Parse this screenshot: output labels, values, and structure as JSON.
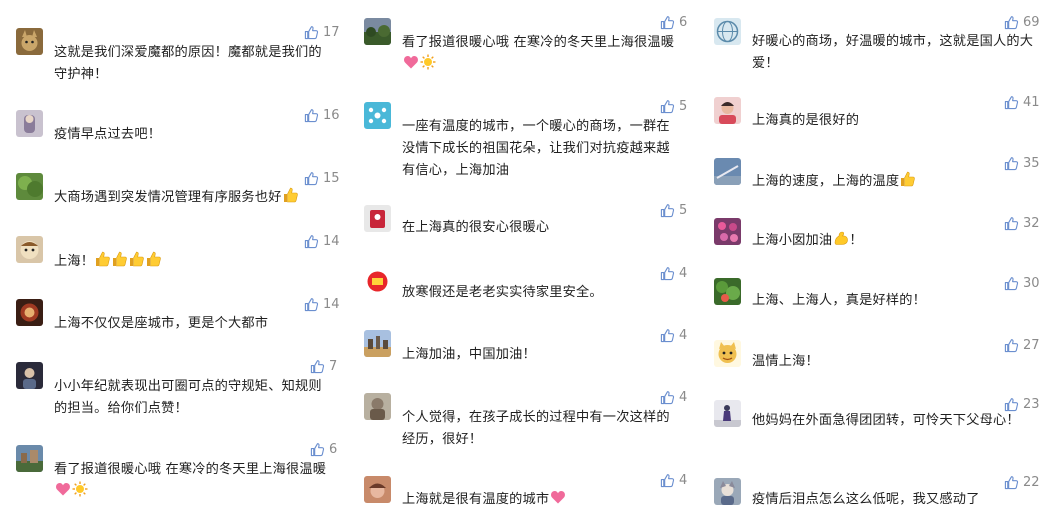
{
  "columns": [
    {
      "comments": [
        {
          "text": "这就是我们深爱魔都的原因！魔都就是我们的守护神！",
          "likes": "17"
        },
        {
          "text": "疫情早点过去吧！",
          "likes": "16"
        },
        {
          "text": "大商场遇到突发情况管理有序服务也好",
          "likes": "15"
        },
        {
          "text": "上海！",
          "likes": "14"
        },
        {
          "text": "上海不仅仅是座城市，更是个大都市",
          "likes": "14"
        },
        {
          "text": "小小年纪就表现出可圈可点的守规矩、知规则的担当。给你们点赞！",
          "likes": "7"
        },
        {
          "text": "看了报道很暖心哦 在寒冷的冬天里上海很温暖",
          "likes": "6"
        }
      ]
    },
    {
      "comments": [
        {
          "text": "看了报道很暖心哦 在寒冷的冬天里上海很温暖",
          "likes": "6"
        },
        {
          "text": "一座有温度的城市，一个暖心的商场，一群在没情下成长的祖国花朵，让我们对抗疫越来越有信心，上海加油",
          "likes": "5"
        },
        {
          "text": "在上海真的很安心很暖心",
          "likes": "5"
        },
        {
          "text": "放寒假还是老老实实待家里安全。",
          "likes": "4"
        },
        {
          "text": "上海加油，中国加油！",
          "likes": "4"
        },
        {
          "text": "个人觉得，在孩子成长的过程中有一次这样的经历，很好！",
          "likes": "4"
        },
        {
          "text": "上海就是很有温度的城市",
          "likes": "4"
        }
      ]
    },
    {
      "comments": [
        {
          "text": "好暖心的商场，好温暖的城市，这就是国人的大爱！",
          "likes": "69"
        },
        {
          "text": "上海真的是很好的",
          "likes": "41"
        },
        {
          "text": "上海的速度，上海的温度",
          "likes": "35"
        },
        {
          "text": "上海小囡加油",
          "likes": "32"
        },
        {
          "text": "上海、上海人，真是好样的！",
          "likes": "30"
        },
        {
          "text": "温情上海！",
          "likes": "27"
        },
        {
          "text": "他妈妈在外面急得团团转，可怜天下父母心！",
          "likes": "23"
        },
        {
          "text": "疫情后泪点怎么这么低呢，我又感动了",
          "likes": "22"
        }
      ]
    }
  ],
  "colors": {
    "text": "#1f1f1f",
    "like": "#8a8a8a",
    "thumb": "#6b8fcf"
  },
  "icons": [
    "thumbs-up-icon",
    "heart-emoji",
    "sun-emoji",
    "thumbs-up-emoji",
    "flexed-bicep-emoji"
  ]
}
